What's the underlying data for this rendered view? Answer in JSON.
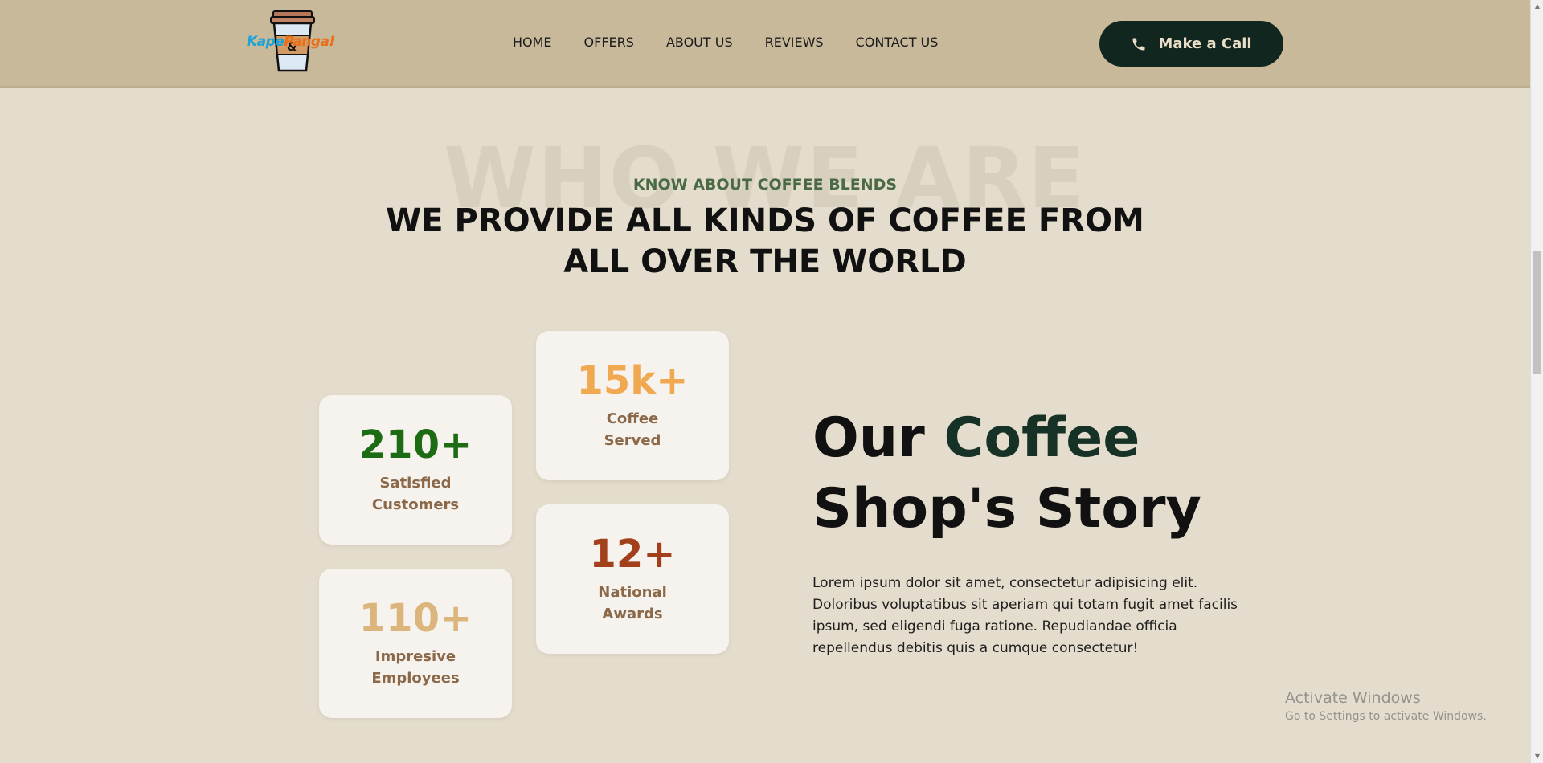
{
  "header": {
    "logo_text_1": "Kape",
    "logo_text_2": "Panga!",
    "nav": [
      "HOME",
      "OFFERS",
      "ABOUT US",
      "REVIEWS",
      "CONTACT US"
    ],
    "call_label": "Make a Call"
  },
  "about": {
    "watermark": "WHO WE ARE",
    "eyebrow": "KNOW ABOUT COFFEE BLENDS",
    "headline_line1": "WE PROVIDE ALL KINDS OF COFFEE FROM",
    "headline_line2": "ALL OVER THE WORLD"
  },
  "stats": [
    {
      "value": "210+",
      "label": "Satisfied Customers",
      "color": "#1d6b12"
    },
    {
      "value": "110+",
      "label": "Impresive Employees",
      "color": "#dcb57c"
    },
    {
      "value": "15k+",
      "label": "Coffee Served",
      "color": "#f0a950"
    },
    {
      "value": "12+",
      "label": "National Awards",
      "color": "#a3401c"
    }
  ],
  "story": {
    "title_part1": "Our ",
    "title_accent": "Coffee",
    "title_line2": "Shop's Story",
    "body": "Lorem ipsum dolor sit amet, consectetur adipisicing elit. Doloribus voluptatibus sit aperiam qui totam fugit amet facilis ipsum, sed eligendi fuga ratione. Repudiandae officia repellendus debitis quis a cumque consectetur!"
  },
  "activation": {
    "title": "Activate Windows",
    "subtitle": "Go to Settings to activate Windows."
  },
  "colors": {
    "page_bg": "#e4ddcd",
    "header_bg": "#c8b99b",
    "button_bg": "#122620",
    "eyebrow": "#4a6a45",
    "label_brown": "#8a6848"
  }
}
